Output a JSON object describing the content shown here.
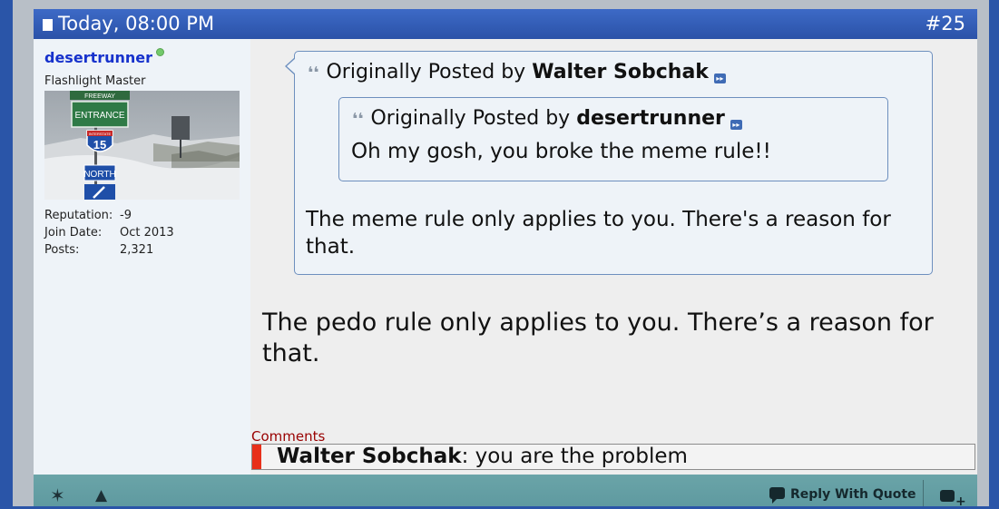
{
  "post": {
    "date": "Today, 08:00 PM",
    "number": "#25"
  },
  "user": {
    "username": "desertrunner",
    "title": "Flashlight Master",
    "reputation_label": "Reputation:",
    "reputation_value": "-9",
    "join_label": "Join Date:",
    "join_value": "Oct 2013",
    "posts_label": "Posts:",
    "posts_value": "2,321",
    "avatar_sign_text": [
      "FREEWAY",
      "ENTRANCE",
      "INTERSTATE",
      "15",
      "NORTH"
    ]
  },
  "quote_outer": {
    "prefix": "Originally Posted by",
    "author": "Walter Sobchak",
    "text": "The meme rule only applies to you. There's a reason for that."
  },
  "quote_inner": {
    "prefix": "Originally Posted by",
    "author": "desertrunner",
    "text": "Oh my gosh, you broke the meme rule!!"
  },
  "message": "The pedo rule only applies to you. There’s a reason for that.",
  "comments": {
    "label": "Comments",
    "items": [
      {
        "author": "Walter Sobchak",
        "text": ": you are the problem"
      }
    ]
  },
  "footer": {
    "reply_with_quote": "Reply With Quote"
  },
  "colors": {
    "header_blue": "#2b52a8",
    "username_blue": "#1732cc",
    "comment_bar": "#e8301a",
    "footer_teal": "#6aa4a8",
    "comments_label": "#990000"
  },
  "icons": [
    "document-icon",
    "online-status-icon",
    "quote-mark-icon",
    "view-post-icon",
    "star-icon",
    "warning-icon",
    "reply-bubble-icon",
    "multiquote-icon"
  ]
}
